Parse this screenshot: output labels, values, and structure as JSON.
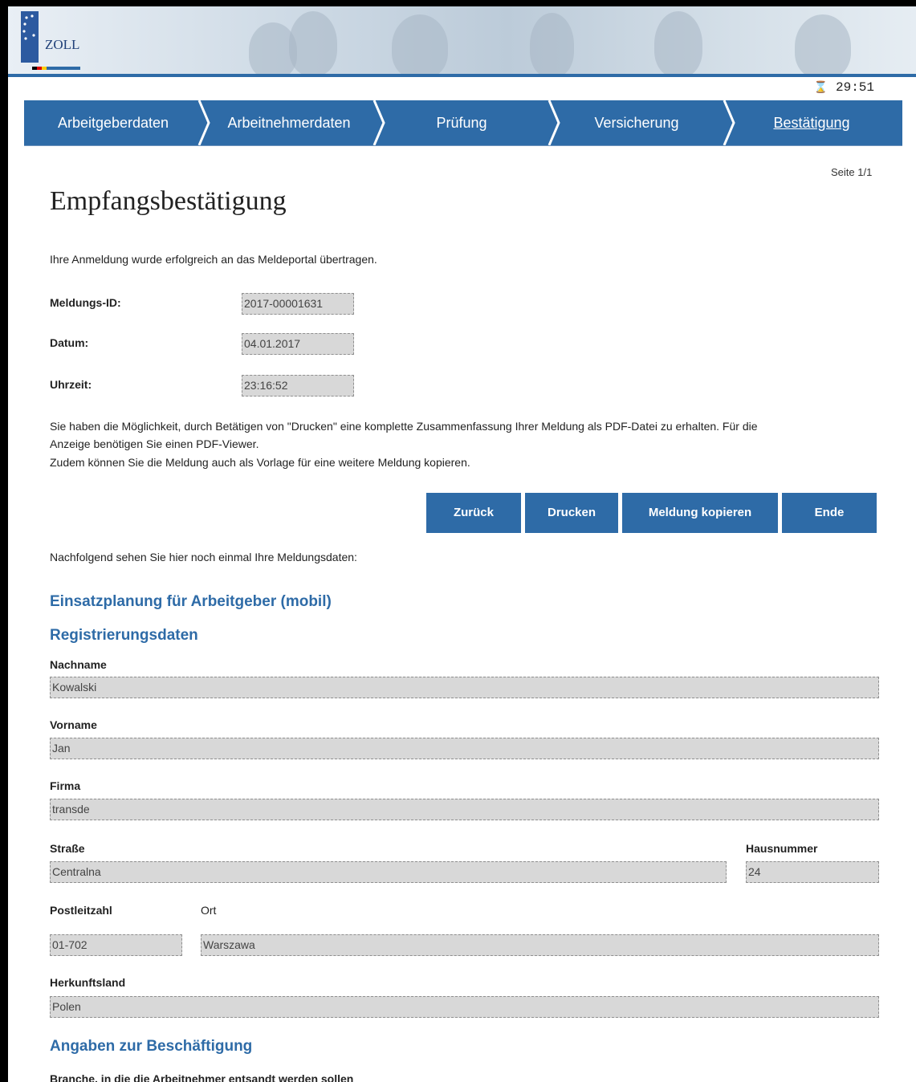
{
  "logo": {
    "text": "ZOLL"
  },
  "timer": {
    "value": "29:51",
    "icon": "hourglass-icon"
  },
  "steps": [
    {
      "label": "Arbeitgeberdaten",
      "active": false
    },
    {
      "label": "Arbeitnehmerdaten",
      "active": false
    },
    {
      "label": "Prüfung",
      "active": false
    },
    {
      "label": "Versicherung",
      "active": false
    },
    {
      "label": "Bestätigung",
      "active": true
    }
  ],
  "page_indicator": "Seite 1/1",
  "title": "Empfangsbestätigung",
  "success_message": "Ihre Anmeldung wurde erfolgreich an das Meldeportal übertragen.",
  "receipt": {
    "id_label": "Meldungs-ID:",
    "id_value": "2017-00001631",
    "date_label": "Datum:",
    "date_value": "04.01.2017",
    "time_label": "Uhrzeit:",
    "time_value": "23:16:52"
  },
  "info": {
    "line1": "Sie haben die Möglichkeit, durch Betätigen von \"Drucken\" eine komplette Zusammenfassung Ihrer Meldung als PDF-Datei zu erhalten. Für die",
    "line2": "Anzeige benötigen Sie einen PDF-Viewer.",
    "line3": "Zudem können Sie die Meldung auch als Vorlage für eine weitere Meldung kopieren."
  },
  "buttons": {
    "back": "Zurück",
    "print": "Drucken",
    "copy": "Meldung kopieren",
    "end": "Ende"
  },
  "followup": "Nachfolgend sehen Sie hier noch einmal Ihre Meldungsdaten:",
  "sections": {
    "planning": "Einsatzplanung für Arbeitgeber (mobil)",
    "registration": "Registrierungsdaten",
    "employment": "Angaben zur Beschäftigung"
  },
  "registration": {
    "lastname_label": "Nachname",
    "lastname_value": "Kowalski",
    "firstname_label": "Vorname",
    "firstname_value": "Jan",
    "company_label": "Firma",
    "company_value": "transde",
    "street_label": "Straße",
    "street_value": "Centralna",
    "housenumber_label": "Hausnummer",
    "housenumber_value": "24",
    "zip_label": "Postleitzahl",
    "zip_value": "01-702",
    "city_label": "Ort",
    "city_value": "Warszawa",
    "country_label": "Herkunftsland",
    "country_value": "Polen"
  },
  "employment": {
    "branch_label": "Branche, in die die Arbeitnehmer entsandt werden sollen"
  },
  "colors": {
    "primary": "#2e6ba7",
    "field_bg": "#d8d8d8"
  }
}
